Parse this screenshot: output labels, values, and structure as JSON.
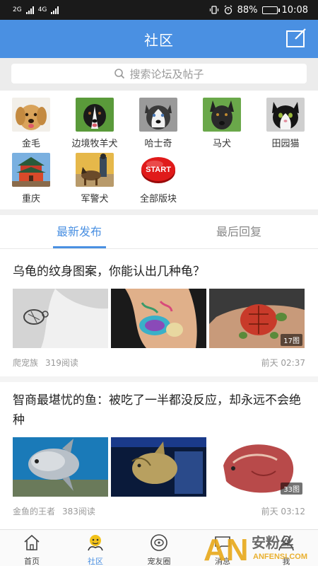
{
  "status_bar": {
    "network_1": "2G",
    "network_2": "4G",
    "battery_level": "88%",
    "time": "10:08",
    "battery_fraction": 0.88
  },
  "header": {
    "title": "社区"
  },
  "search": {
    "placeholder": "搜索论坛及帖子"
  },
  "categories": [
    {
      "label": "金毛",
      "icon": "golden-retriever"
    },
    {
      "label": "边境牧羊犬",
      "icon": "border-collie"
    },
    {
      "label": "哈士奇",
      "icon": "husky"
    },
    {
      "label": "马犬",
      "icon": "malinois"
    },
    {
      "label": "田园猫",
      "icon": "cat"
    },
    {
      "label": "重庆",
      "icon": "chongqing-building"
    },
    {
      "label": "军警犬",
      "icon": "police-dog"
    },
    {
      "label": "全部版块",
      "icon": "start-button",
      "badge": "START"
    }
  ],
  "tabs": [
    {
      "label": "最新发布",
      "active": true
    },
    {
      "label": "最后回复",
      "active": false
    }
  ],
  "posts": [
    {
      "title": "乌龟的纹身图案，你能认出几种龟？",
      "author": "爬宠族",
      "reads": "319阅读",
      "time": "前天 02:37",
      "image_count": "17图"
    },
    {
      "title": "智商最堪忧的鱼：被吃了一半都没反应，却永远不会绝种",
      "author": "金鱼的王者",
      "reads": "383阅读",
      "time": "前天 03:12",
      "image_count": "33图"
    }
  ],
  "bottom_nav": [
    {
      "label": "首页",
      "active": false
    },
    {
      "label": "社区",
      "active": true
    },
    {
      "label": "宠友圈",
      "active": false
    },
    {
      "label": "消息",
      "active": false
    },
    {
      "label": "我",
      "active": false
    }
  ],
  "watermark": {
    "brand": "AN",
    "text": "安粉丝",
    "sub": "ANFENSI.COM"
  },
  "colors": {
    "accent": "#4a90e2",
    "status_bar": "#1a1a1a",
    "text": "#222222",
    "meta": "#999999"
  }
}
